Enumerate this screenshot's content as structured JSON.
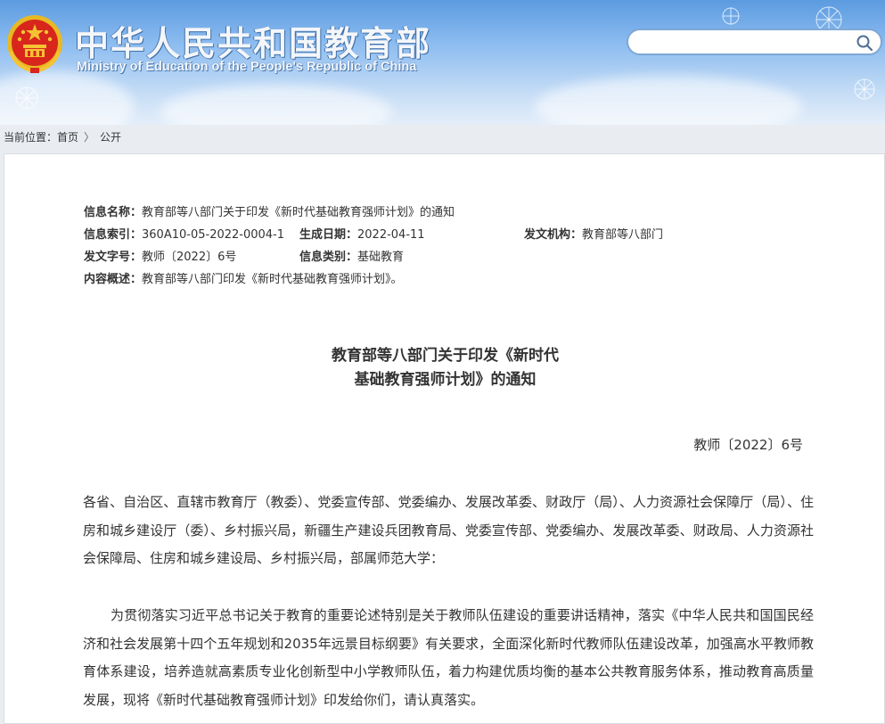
{
  "header": {
    "site_title": "中华人民共和国教育部",
    "site_subtitle": "Ministry of Education of the People's Republic of China",
    "search_placeholder": "",
    "colors": {
      "sky_top": "#5c9be0",
      "sky_bottom": "#e4eef9",
      "emblem_red": "#d8261c",
      "emblem_gold": "#f5c233"
    }
  },
  "breadcrumb": {
    "prefix": "当前位置：",
    "items": [
      "首页",
      "公开"
    ],
    "separator": "〉"
  },
  "meta": {
    "name_label": "信息名称：",
    "name_value": "教育部等八部门关于印发《新时代基础教育强师计划》的通知",
    "index_label": "信息索引：",
    "index_value": "360A10-05-2022-0004-1",
    "date_label": "生成日期：",
    "date_value": "2022-04-11",
    "org_label": "发文机构：",
    "org_value": "教育部等八部门",
    "doc_no_label": "发文字号：",
    "doc_no_value": "教师〔2022〕6号",
    "category_label": "信息类别：",
    "category_value": "基础教育",
    "summary_label": "内容概述：",
    "summary_value": "教育部等八部门印发《新时代基础教育强师计划》。"
  },
  "document": {
    "title_line1": "教育部等八部门关于印发《新时代",
    "title_line2": "基础教育强师计划》的通知",
    "number": "教师〔2022〕6号",
    "addressees": "各省、自治区、直辖市教育厅（教委）、党委宣传部、党委编办、发展改革委、财政厅（局）、人力资源社会保障厅（局）、住房和城乡建设厅（委）、乡村振兴局，新疆生产建设兵团教育局、党委宣传部、党委编办、发展改革委、财政局、人力资源社会保障局、住房和城乡建设局、乡村振兴局，部属师范大学：",
    "body": "为贯彻落实习近平总书记关于教育的重要论述特别是关于教师队伍建设的重要讲话精神，落实《中华人民共和国国民经济和社会发展第十四个五年规划和2035年远景目标纲要》有关要求，全面深化新时代教师队伍建设改革，加强高水平教师教育体系建设，培养造就高素质专业化创新型中小学教师队伍，着力构建优质均衡的基本公共教育服务体系，推动教育高质量发展，现将《新时代基础教育强师计划》印发给你们，请认真落实。"
  }
}
